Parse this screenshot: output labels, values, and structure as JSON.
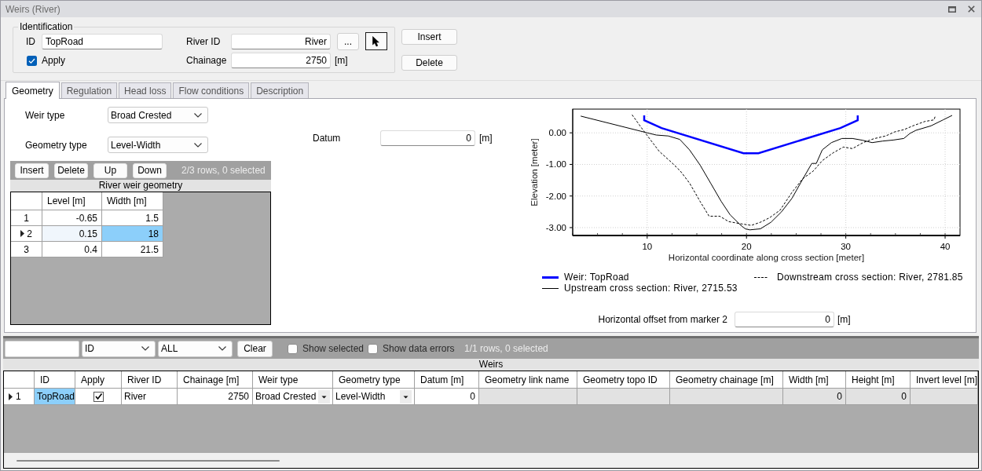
{
  "window": {
    "title": "Weirs (River)"
  },
  "identification": {
    "title": "Identification",
    "id": {
      "label": "ID",
      "value": "TopRoad"
    },
    "apply": {
      "label": "Apply",
      "checked": true
    },
    "river_id": {
      "label": "River ID",
      "value": "River"
    },
    "browse_button": "...",
    "chainage": {
      "label": "Chainage",
      "value": "2750",
      "unit": "[m]"
    }
  },
  "actions": [
    "Insert",
    "Delete"
  ],
  "tabs": [
    {
      "label": "Geometry",
      "selected": true
    },
    {
      "label": "Regulation",
      "selected": false
    },
    {
      "label": "Head loss",
      "selected": false
    },
    {
      "label": "Flow conditions",
      "selected": false
    },
    {
      "label": "Description",
      "selected": false
    }
  ],
  "geometry": {
    "weir_type": {
      "label": "Weir type",
      "value": "Broad Crested"
    },
    "geometry_type": {
      "label": "Geometry type",
      "value": "Level-Width"
    },
    "grid": {
      "buttons": [
        "Insert",
        "Delete",
        "Up",
        "Down"
      ],
      "status": "2/3 rows, 0 selected",
      "title": "River weir geometry",
      "columns": [
        "Level [m]",
        "Width [m]"
      ],
      "rows": [
        {
          "number": "1",
          "current": false,
          "cells": [
            {
              "value": "-0.65",
              "selected": false
            },
            {
              "value": "1.5",
              "selected": false
            }
          ]
        },
        {
          "number": "2",
          "current": true,
          "cells": [
            {
              "value": "0.15",
              "selected": false
            },
            {
              "value": "18",
              "selected": true
            }
          ]
        },
        {
          "number": "3",
          "current": false,
          "cells": [
            {
              "value": "0.4",
              "selected": false
            },
            {
              "value": "21.5",
              "selected": false
            }
          ]
        }
      ]
    },
    "datum": {
      "label": "Datum",
      "value": "0",
      "unit": "[m]"
    },
    "chart": {
      "chart_data": {
        "type": "line",
        "xlabel": "Horizontal coordinate along cross section [meter]",
        "ylabel": "Elevation [meter]",
        "xlim": [
          2.5,
          41.5
        ],
        "ylim": [
          -3.25,
          0.75
        ],
        "xticks": [
          10,
          20,
          30,
          40
        ],
        "yticks": [
          {
            "value": 0,
            "label": "0.00"
          },
          {
            "value": -1,
            "label": "-1.00"
          },
          {
            "value": -2,
            "label": "-2.00"
          },
          {
            "value": -3,
            "label": "-3.00"
          }
        ],
        "grid": true,
        "series": [
          {
            "name": "Weir: TopRoad",
            "color": "#0000ff",
            "line_style": "solid",
            "x": [
              9.7,
              9.7,
              11.45,
              19.7,
              21.2,
              29.45,
              31.2,
              31.2
            ],
            "values": [
              0.55,
              0.4,
              0.15,
              -0.65,
              -0.65,
              0.15,
              0.4,
              0.55
            ]
          },
          {
            "name": "Upstream cross section: River, 2715.53",
            "color": "#000000",
            "line_style": "solid",
            "x": [
              3.31,
              10,
              10.91,
              12.13,
              13.28,
              14.26,
              15.32,
              16.38,
              17.45,
              18.36,
              19.43,
              19.88,
              20.34,
              21.4,
              22.47,
              23.53,
              24.59,
              25.51,
              26.57,
              27.03,
              27.63,
              28.55,
              29.61,
              30.67,
              31.74,
              32.65,
              33.72,
              34.78,
              35.84,
              36.45,
              37.06,
              38.58,
              39.8,
              40.71
            ],
            "values": [
              0.53,
              0,
              -0.07,
              -0.1,
              -0.21,
              -0.54,
              -1.02,
              -1.59,
              -2.17,
              -2.6,
              -2.93,
              -3.04,
              -3.07,
              -3.04,
              -2.83,
              -2.5,
              -2.07,
              -1.55,
              -0.97,
              -0.97,
              -0.54,
              -0.31,
              -0.18,
              -0.18,
              -0.24,
              -0.31,
              -0.26,
              -0.23,
              -0.18,
              -0.02,
              0.08,
              0.22,
              0.41,
              0.55
            ]
          },
          {
            "name": "Downstream cross section: River, 2781.85",
            "color": "#000000",
            "line_style": "dashed",
            "x": [
              8.48,
              9.39,
              10.3,
              11.22,
              12.43,
              13.34,
              14.26,
              15.32,
              16.23,
              17.3,
              18.21,
              19.43,
              20.49,
              21.4,
              22.31,
              23.38,
              24.59,
              25.66,
              26.72,
              27.63,
              28.7,
              29.76,
              30.67,
              31.74,
              32.8,
              34.02,
              34.93,
              35.84,
              36.76,
              37.97,
              38.88,
              39.03
            ],
            "values": [
              0.57,
              0.17,
              -0.21,
              -0.59,
              -0.93,
              -1.21,
              -1.59,
              -2.17,
              -2.64,
              -2.64,
              -2.81,
              -2.88,
              -2.93,
              -2.83,
              -2.69,
              -2.45,
              -1.88,
              -1.45,
              -1.21,
              -0.88,
              -0.64,
              -0.45,
              -0.5,
              -0.31,
              -0.19,
              -0.1,
              0.03,
              0.1,
              0.22,
              0.36,
              0.41,
              0.55
            ]
          }
        ]
      }
    },
    "offset": {
      "label": "Horizontal offset from marker 2",
      "value": "0",
      "unit": "[m]"
    }
  },
  "weirs": {
    "filter": {
      "column": "ID",
      "value": "ALL",
      "clear_button": "Clear",
      "show_selected": {
        "label": "Show selected",
        "checked": false
      },
      "show_errors": {
        "label": "Show data errors",
        "checked": false
      },
      "status": "1/1 rows, 0 selected"
    },
    "title": "Weirs",
    "columns": [
      "ID",
      "Apply",
      "River ID",
      "Chainage [m]",
      "Weir type",
      "Geometry type",
      "Datum [m]",
      "Geometry link name",
      "Geometry topo ID",
      "Geometry chainage [m]",
      "Width [m]",
      "Height [m]",
      "Invert level [m]"
    ],
    "rows": [
      {
        "number": "1",
        "current": true,
        "cells": [
          {
            "kind": "text",
            "value": "TopRoad",
            "readonly": false,
            "selected": true
          },
          {
            "kind": "check",
            "checked": true,
            "readonly": false,
            "selected": false
          },
          {
            "kind": "text",
            "value": "River",
            "readonly": false,
            "selected": false
          },
          {
            "kind": "number",
            "value": "2750",
            "readonly": false,
            "selected": false
          },
          {
            "kind": "combo",
            "value": "Broad Crested",
            "readonly": false,
            "selected": false
          },
          {
            "kind": "combo",
            "value": "Level-Width",
            "readonly": false,
            "selected": false
          },
          {
            "kind": "number",
            "value": "0",
            "readonly": false,
            "selected": false
          },
          {
            "kind": "text",
            "readonly": true,
            "selected": false
          },
          {
            "kind": "text",
            "readonly": true,
            "selected": false
          },
          {
            "kind": "number",
            "readonly": true,
            "selected": false
          },
          {
            "kind": "number",
            "value": "0",
            "readonly": true,
            "selected": false
          },
          {
            "kind": "number",
            "value": "0",
            "readonly": true,
            "selected": false
          },
          {
            "kind": "number",
            "readonly": true,
            "selected": false
          }
        ]
      }
    ]
  }
}
